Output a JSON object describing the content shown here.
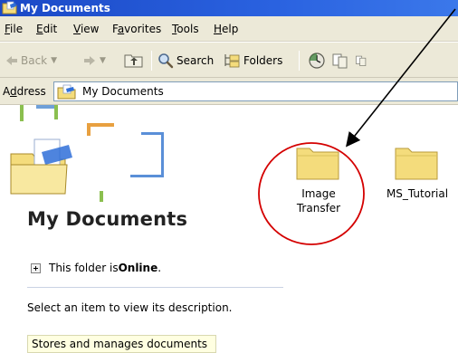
{
  "window": {
    "title": "My Documents"
  },
  "menu": [
    {
      "accel": "F",
      "rest": "ile"
    },
    {
      "accel": "E",
      "rest": "dit"
    },
    {
      "accel": "V",
      "rest": "iew"
    },
    {
      "pre": "F",
      "accel": "a",
      "rest": "vorites"
    },
    {
      "accel": "T",
      "rest": "ools"
    },
    {
      "accel": "H",
      "rest": "elp"
    }
  ],
  "toolbar": {
    "back_label": "Back",
    "search_label": "Search",
    "folders_label": "Folders"
  },
  "address": {
    "label_pre": "A",
    "label_acc": "d",
    "label_rest": "dress",
    "value": "My Documents"
  },
  "pane": {
    "heading": "My Documents",
    "status_prefix": "This folder is ",
    "status_bold": "Online",
    "status_suffix": ".",
    "description_prompt": "Select an item to view its description.",
    "tooltip": "Stores and manages documents"
  },
  "folders": [
    {
      "line1": "Image",
      "line2": "Transfer"
    },
    {
      "line1": "MS_Tutorial",
      "line2": ""
    }
  ],
  "colors": {
    "title_bar": "#2a62e0",
    "chrome": "#ece9d8",
    "annotation": "#d40000",
    "folder": "#f4dc7c"
  }
}
